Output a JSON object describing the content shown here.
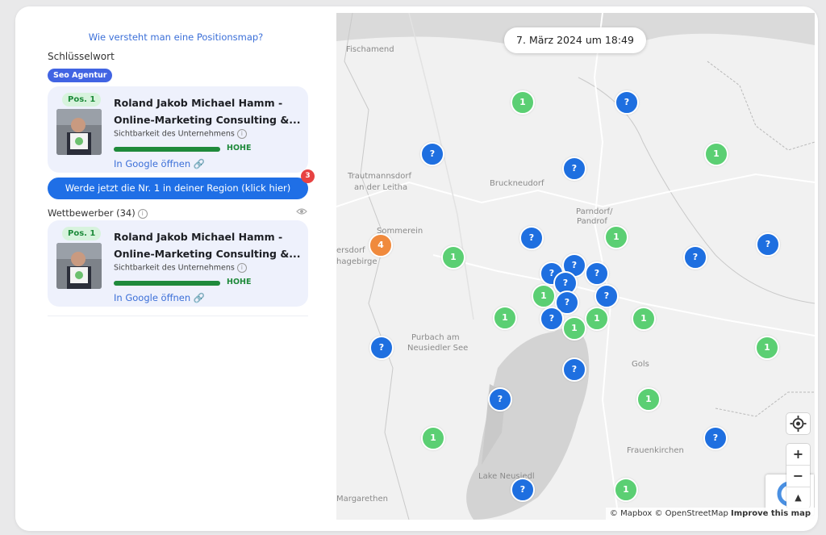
{
  "sidebar": {
    "help_link": "Wie versteht man eine Positionsmap?",
    "keyword_label": "Schlüsselwort",
    "keyword_chip": "Seo Agentur",
    "top_result": {
      "position": "Pos. 1",
      "title_line1": "Roland Jakob Michael Hamm -",
      "title_line2": "Online-Marketing Consulting &...",
      "visibility_label": "Sichtbarkeit des Unternehmens",
      "visibility_level": "HOHE",
      "visibility_fraction": 1.0,
      "google_link": "In Google öffnen"
    },
    "cta_button": "Werde jetzt die Nr. 1 in deiner Region (klick hier)",
    "cta_badge": "3",
    "competitors_label": "Wettbewerber (34)",
    "competitor_result": {
      "position": "Pos. 1",
      "title_line1": "Roland Jakob Michael Hamm -",
      "title_line2": "Online-Marketing Consulting &...",
      "visibility_label": "Sichtbarkeit des Unternehmens",
      "visibility_level": "HOHE",
      "visibility_fraction": 1.0,
      "google_link": "In Google öffnen"
    }
  },
  "map": {
    "date": "7. März 2024 um 18:49",
    "places": [
      "Fischamend",
      "Trautmannsdorf",
      "an der Leitha",
      "Bruckneudorf",
      "Parndorf/",
      "Pandrof",
      "Sommerein",
      "ersdorf",
      "hagebirge",
      "Purbach am",
      "Neusiedler See",
      "Gols",
      "Frauenkirchen",
      "Lake Neusiedl",
      "Margarethen"
    ],
    "markers": [
      {
        "label": "1",
        "color": "#5bcf73"
      },
      {
        "label": "?",
        "color": "#1e6fe0"
      },
      {
        "label": "?",
        "color": "#1e6fe0"
      },
      {
        "label": "1",
        "color": "#5bcf73"
      },
      {
        "label": "?",
        "color": "#1e6fe0"
      },
      {
        "label": "4",
        "color": "#f08a3d"
      },
      {
        "label": "1",
        "color": "#5bcf73"
      },
      {
        "label": "?",
        "color": "#1e6fe0"
      },
      {
        "label": "1",
        "color": "#5bcf73"
      },
      {
        "label": "?",
        "color": "#1e6fe0"
      },
      {
        "label": "?",
        "color": "#1e6fe0"
      },
      {
        "label": "1",
        "color": "#5bcf73"
      },
      {
        "label": "1",
        "color": "#5bcf73"
      },
      {
        "label": "?",
        "color": "#1e6fe0"
      },
      {
        "label": "?",
        "color": "#1e6fe0"
      },
      {
        "label": "1",
        "color": "#5bcf73"
      },
      {
        "label": "1",
        "color": "#5bcf73"
      },
      {
        "label": "1",
        "color": "#5bcf73"
      },
      {
        "label": "?",
        "color": "#1e6fe0"
      },
      {
        "label": "1",
        "color": "#5bcf73"
      },
      {
        "label": "?",
        "color": "#1e6fe0"
      },
      {
        "label": "?",
        "color": "#1e6fe0"
      },
      {
        "label": "1",
        "color": "#5bcf73"
      },
      {
        "label": "?",
        "color": "#1e6fe0"
      },
      {
        "label": "?",
        "color": "#1e6fe0"
      },
      {
        "label": "?",
        "color": "#1e6fe0"
      },
      {
        "label": "?",
        "color": "#1e6fe0"
      },
      {
        "label": "?",
        "color": "#1e6fe0"
      },
      {
        "label": "?",
        "color": "#1e6fe0"
      },
      {
        "label": "?",
        "color": "#1e6fe0"
      },
      {
        "label": "1",
        "color": "#5bcf73"
      },
      {
        "label": "1",
        "color": "#5bcf73"
      }
    ],
    "zoom_in": "+",
    "zoom_out": "−",
    "compass": "▲",
    "attribution": "© Mapbox © OpenStreetMap",
    "improve_link": "Improve this map"
  },
  "colors": {
    "accent_blue": "#1f6fe6",
    "visibility_green": "#1f8a3b",
    "marker_blue": "#1e6fe0",
    "marker_green": "#5bcf73",
    "marker_orange": "#f08a3d",
    "badge_red": "#e74242"
  }
}
